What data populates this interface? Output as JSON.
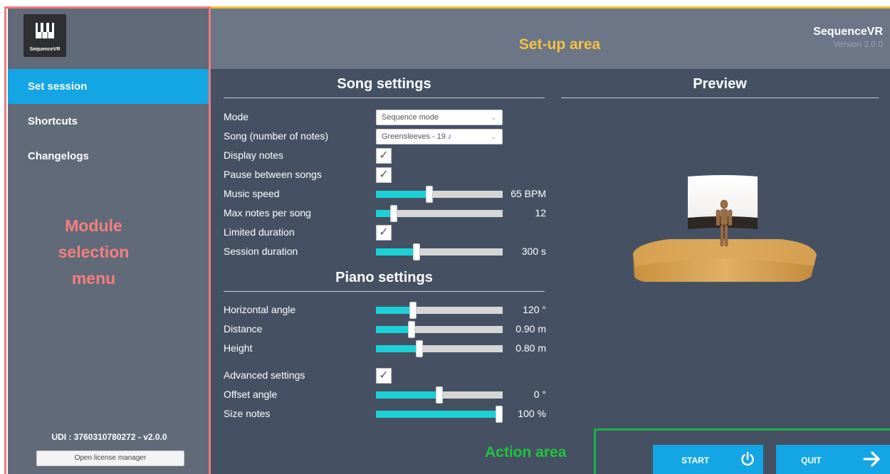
{
  "app": {
    "name": "SequenceVR",
    "version": "Version 2.0.0",
    "logo_text": "SequenceVR"
  },
  "annotations": {
    "setup_area": "Set-up area",
    "module_menu_lines": [
      "Module",
      "selection",
      "menu"
    ],
    "action_area": "Action area"
  },
  "sidebar": {
    "items": [
      {
        "label": "Set session",
        "active": true
      },
      {
        "label": "Shortcuts",
        "active": false
      },
      {
        "label": "Changelogs",
        "active": false
      }
    ],
    "udi": "UDI : 3760310780272 - v2.0.0",
    "license_button": "Open license manager"
  },
  "song_settings": {
    "title": "Song settings",
    "mode_label": "Mode",
    "mode_value": "Sequence mode",
    "song_label": "Song (number of notes)",
    "song_value": "Greensleeves - 19 ♪",
    "display_notes_label": "Display notes",
    "display_notes": true,
    "pause_label": "Pause between songs",
    "pause": true,
    "music_speed_label": "Music speed",
    "music_speed_value": "65 BPM",
    "music_speed_fraction": 0.42,
    "max_notes_label": "Max notes per song",
    "max_notes_value": "12",
    "max_notes_fraction": 0.14,
    "limited_duration_label": "Limited duration",
    "limited_duration": true,
    "session_duration_label": "Session duration",
    "session_duration_value": "300 s",
    "session_duration_fraction": 0.32
  },
  "piano_settings": {
    "title": "Piano settings",
    "horizontal_angle_label": "Horizontal angle",
    "horizontal_angle_value": "120 °",
    "horizontal_angle_fraction": 0.29,
    "distance_label": "Distance",
    "distance_value": "0.90 m",
    "distance_fraction": 0.28,
    "height_label": "Height",
    "height_value": "0.80 m",
    "height_fraction": 0.34,
    "advanced_label": "Advanced settings",
    "advanced": true,
    "offset_angle_label": "Offset angle",
    "offset_angle_value": "0 °",
    "offset_angle_fraction": 0.5,
    "size_notes_label": "Size notes",
    "size_notes_value": "100 %",
    "size_notes_fraction": 1.0
  },
  "preview": {
    "title": "Preview"
  },
  "actions": {
    "start": "START",
    "quit": "QUIT"
  },
  "colors": {
    "accent": "#14a5e5",
    "slider_fill": "#1bd1d6",
    "sidebar_bg": "#616a78",
    "main_bg": "#455163"
  }
}
